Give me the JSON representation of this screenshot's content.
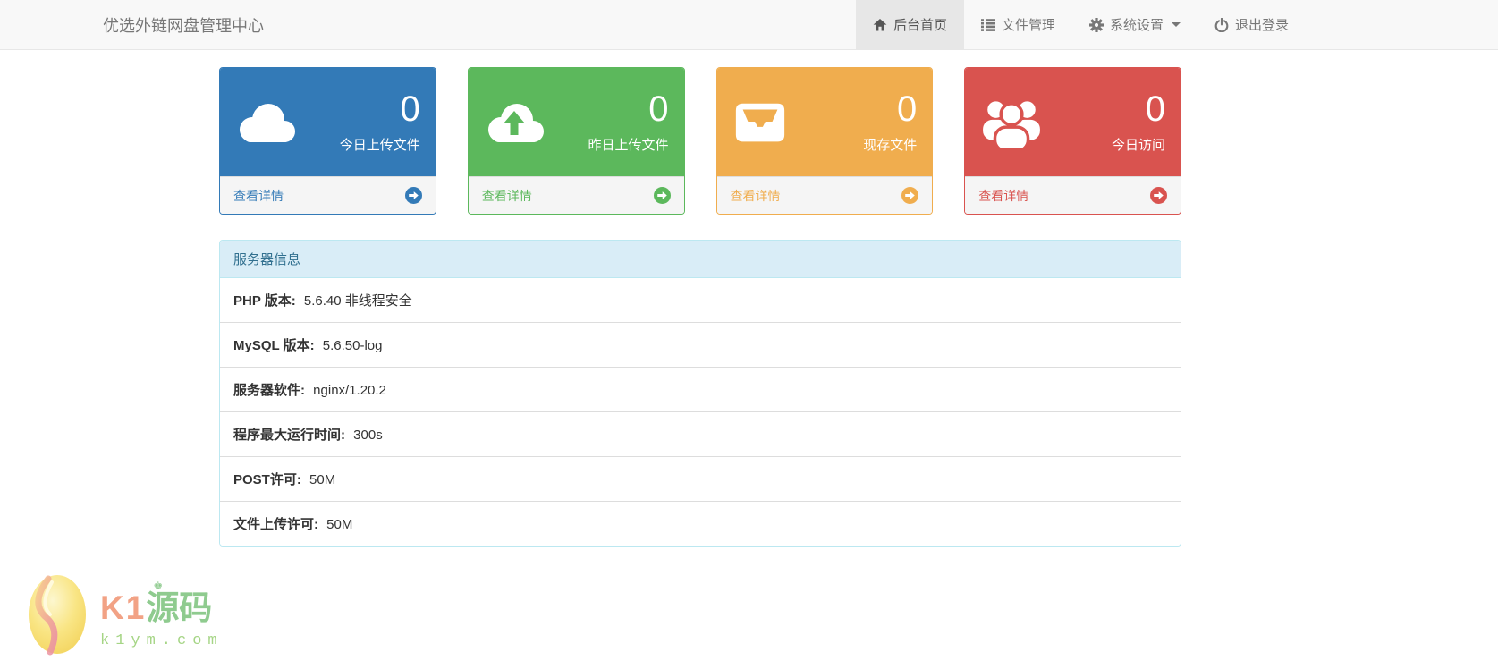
{
  "navbar": {
    "brand": "优选外链网盘管理中心",
    "items": [
      {
        "label": "后台首页",
        "icon": "home-icon",
        "active": true
      },
      {
        "label": "文件管理",
        "icon": "list-icon",
        "active": false
      },
      {
        "label": "系统设置",
        "icon": "gear-icon",
        "active": false,
        "has_caret": true
      },
      {
        "label": "退出登录",
        "icon": "power-icon",
        "active": false
      }
    ]
  },
  "stat_cards": [
    {
      "value": "0",
      "label": "今日上传文件",
      "link_label": "查看详情",
      "icon": "cloud-icon",
      "color": "#337ab7"
    },
    {
      "value": "0",
      "label": "昨日上传文件",
      "link_label": "查看详情",
      "icon": "cloud-upload-icon",
      "color": "#5cb85c"
    },
    {
      "value": "0",
      "label": "现存文件",
      "link_label": "查看详情",
      "icon": "inbox-icon",
      "color": "#f0ad4e"
    },
    {
      "value": "0",
      "label": "今日访问",
      "link_label": "查看详情",
      "icon": "users-icon",
      "color": "#d9534f"
    }
  ],
  "server_panel": {
    "title": "服务器信息",
    "rows": [
      {
        "label": "PHP 版本:",
        "value": "5.6.40 非线程安全"
      },
      {
        "label": "MySQL 版本:",
        "value": "5.6.50-log"
      },
      {
        "label": "服务器软件:",
        "value": "nginx/1.20.2"
      },
      {
        "label": "程序最大运行时间:",
        "value": "300s"
      },
      {
        "label": "POST许可:",
        "value": "50M"
      },
      {
        "label": "文件上传许可:",
        "value": "50M"
      }
    ]
  },
  "watermark": {
    "brand_latin": "K1",
    "brand_cn": "源码",
    "site": "k1ym.com",
    "colors": {
      "latin": "#f2a285",
      "cn": "#8fcb8f",
      "site": "#a5d585",
      "egg": "#f7e07a"
    }
  },
  "icons": {
    "nav": [
      "home-icon",
      "list-icon",
      "gear-icon",
      "power-icon",
      "caret-down-icon"
    ],
    "cards": [
      "cloud-icon",
      "cloud-upload-icon",
      "inbox-icon",
      "users-icon",
      "arrow-circle-right-icon"
    ]
  }
}
